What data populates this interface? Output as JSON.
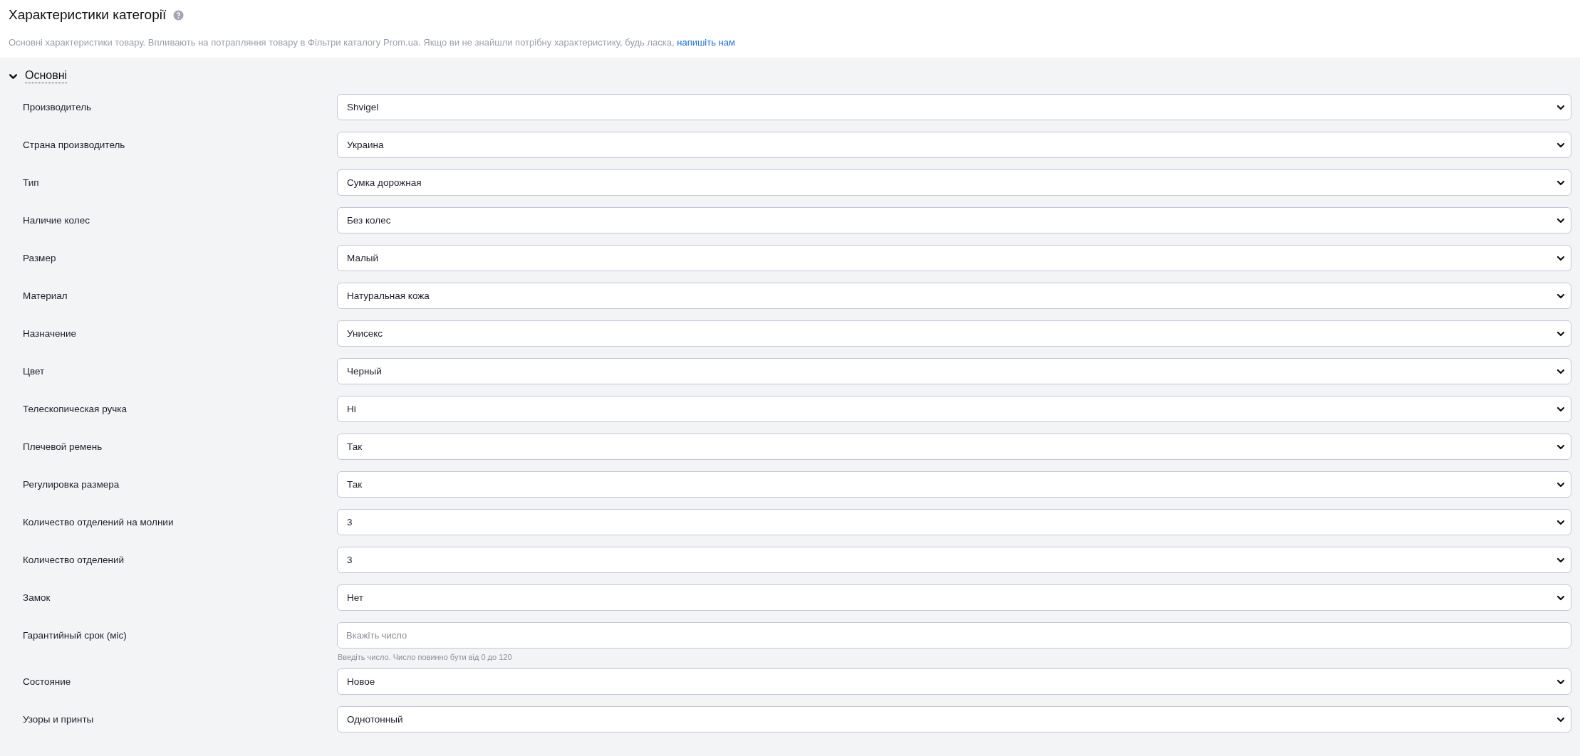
{
  "header": {
    "title": "Характеристики категорії",
    "description": "Основні характеристики товару. Впливають на потрапляння товару в Фільтри каталогу Prom.ua. Якщо ви не знайшли потрібну характеристику, будь ласка,",
    "link": "напишіть нам"
  },
  "section": {
    "title": "Основні",
    "expanded": true,
    "fields": [
      {
        "kind": "select",
        "label": "Производитель",
        "value": "Shvigel"
      },
      {
        "kind": "select",
        "label": "Страна производитель",
        "value": "Украина"
      },
      {
        "kind": "select",
        "label": "Тип",
        "value": "Сумка дорожная"
      },
      {
        "kind": "select",
        "label": "Наличие колес",
        "value": "Без колес"
      },
      {
        "kind": "select",
        "label": "Размер",
        "value": "Малый"
      },
      {
        "kind": "select",
        "label": "Материал",
        "value": "Натуральная кожа"
      },
      {
        "kind": "select",
        "label": "Назначение",
        "value": "Унисекс"
      },
      {
        "kind": "select",
        "label": "Цвет",
        "value": "Черный"
      },
      {
        "kind": "select",
        "label": "Телескопическая ручка",
        "value": "Ні"
      },
      {
        "kind": "select",
        "label": "Плечевой ремень",
        "value": "Так"
      },
      {
        "kind": "select",
        "label": "Регулировка размера",
        "value": "Так"
      },
      {
        "kind": "select",
        "label": "Количество отделений на молнии",
        "value": "3"
      },
      {
        "kind": "select",
        "label": "Количество отделений",
        "value": "3"
      },
      {
        "kind": "select",
        "label": "Замок",
        "value": "Нет"
      },
      {
        "kind": "number",
        "label": "Гарантийный срок (міс)",
        "placeholder": "Вкажіть число",
        "hint": "Введіть число. Число повинно бути від 0 до 120"
      },
      {
        "kind": "select",
        "label": "Состояние",
        "value": "Новое"
      },
      {
        "kind": "select",
        "label": "Узоры и принты",
        "value": "Однотонный"
      }
    ]
  }
}
